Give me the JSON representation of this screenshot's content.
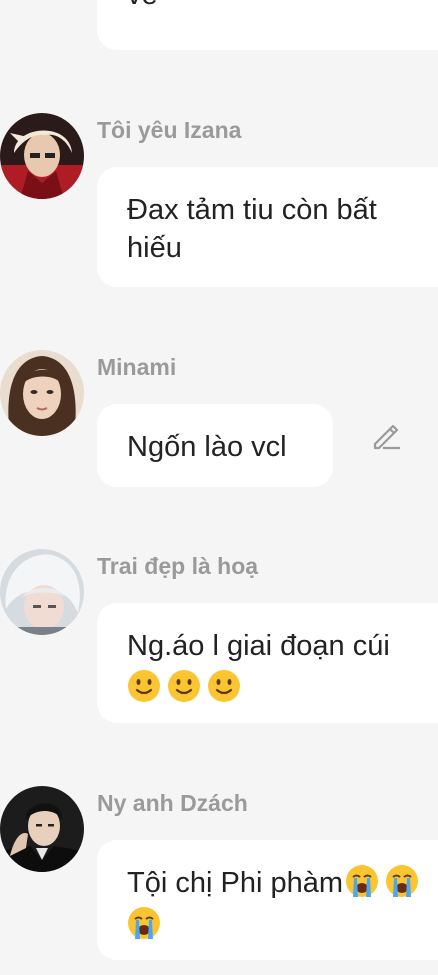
{
  "messages": [
    {
      "id": "top",
      "text": "vẻ"
    },
    {
      "id": "m1",
      "sender": "Tôi yêu Izana",
      "line1": "Đax tảm tiu còn bất",
      "line2": "hiếu"
    },
    {
      "id": "m2",
      "sender": "Minami",
      "line1": "Ngốn lào vcl"
    },
    {
      "id": "m3",
      "sender": "Trai đẹp là hoạ",
      "line1": "Ng.áo l giai đoạn cúi"
    },
    {
      "id": "m4",
      "sender": "Ny anh Dzách",
      "line1": "Tội chị Phi phàm"
    }
  ],
  "icons": {
    "edit": "pencil-icon",
    "smile": "slightly-smiling-face",
    "cry": "loudly-crying-face"
  },
  "colors": {
    "background": "#f5f5f5",
    "bubble": "#ffffff",
    "sender": "#9a9a9a",
    "text": "#222222"
  }
}
